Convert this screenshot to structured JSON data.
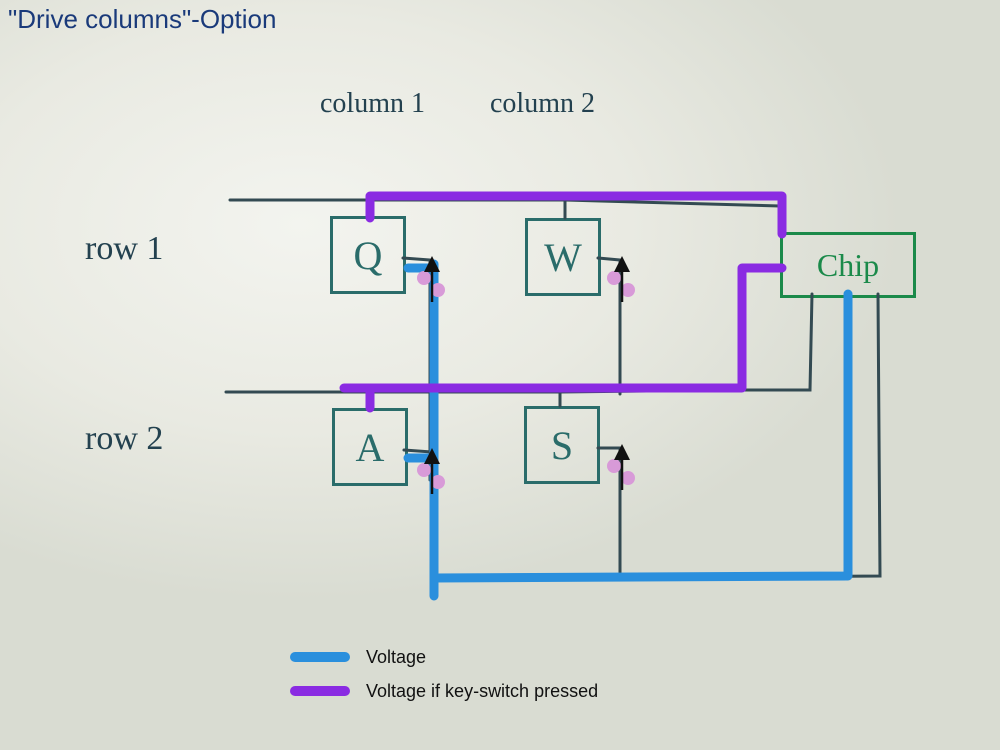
{
  "title": "\"Drive columns\"-Option",
  "columns": [
    "column 1",
    "column 2"
  ],
  "rows": [
    "row 1",
    "row 2"
  ],
  "keys": [
    {
      "label": "Q",
      "row": 0,
      "col": 0
    },
    {
      "label": "W",
      "row": 0,
      "col": 1
    },
    {
      "label": "A",
      "row": 1,
      "col": 0
    },
    {
      "label": "S",
      "row": 1,
      "col": 1
    }
  ],
  "chip": {
    "label": "Chip"
  },
  "legend": [
    {
      "color": "#2a8fdd",
      "label": "Voltage"
    },
    {
      "color": "#8a2be2",
      "label": "Voltage if key-switch pressed"
    }
  ],
  "chart_data": {
    "type": "diagram",
    "description": "2×2 keyboard-matrix with diodes; chip drives columns (blue = driven voltage on column 1), rows read back (purple = voltage on a row when its key-switch is pressed).",
    "matrix": {
      "rows": [
        "row 1",
        "row 2"
      ],
      "columns": [
        "column 1",
        "column 2"
      ],
      "keys": [
        [
          "Q",
          "W"
        ],
        [
          "A",
          "S"
        ]
      ]
    },
    "driven_column": "column 1",
    "signal_paths": {
      "voltage_blue": "chip → column 1 line → diodes of Q and A",
      "voltage_purple_if_pressed": "key → its row line → chip (row 1 and row 2 inputs)"
    },
    "components": {
      "diodes": 4,
      "chip": 1
    }
  }
}
